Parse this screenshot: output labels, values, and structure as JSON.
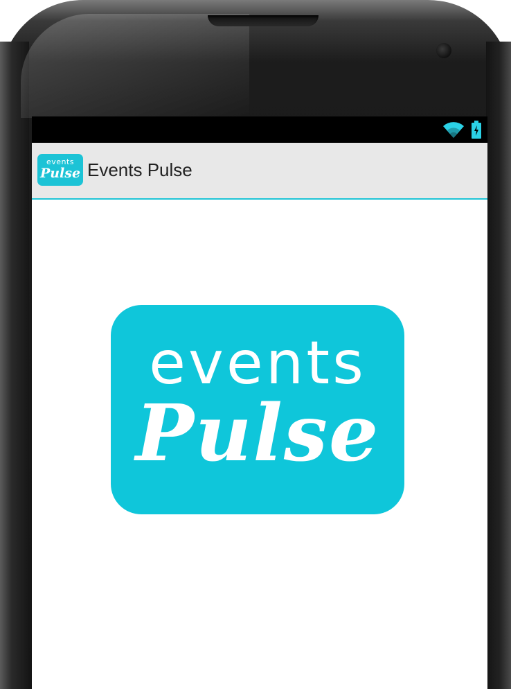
{
  "device": {
    "type": "phone"
  },
  "status_bar": {
    "icons": [
      "wifi-icon",
      "battery-icon"
    ]
  },
  "action_bar": {
    "app_icon": {
      "line1": "events",
      "line2": "Pulse"
    },
    "title": "Events Pulse"
  },
  "splash": {
    "logo_line1": "events",
    "logo_line2": "Pulse"
  },
  "colors": {
    "accent": "#0fc6da",
    "action_bar_bg": "#e8e8e8",
    "status_bar_bg": "#000000",
    "divider": "#1ec4d6"
  }
}
